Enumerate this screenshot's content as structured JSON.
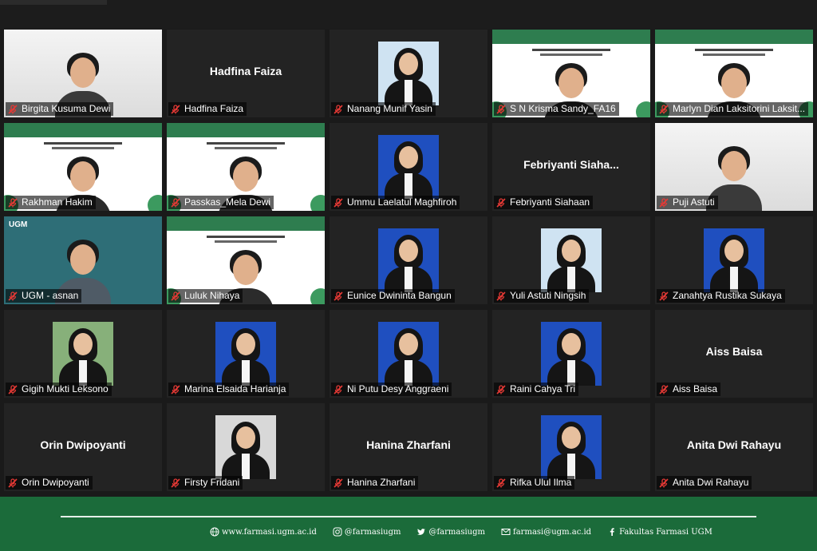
{
  "colors": {
    "background": "#1a1a1a",
    "tile": "#232323",
    "footer": "#1b6b3a",
    "active_border": "#d9e35a",
    "mic_off": "#e53935"
  },
  "participants": [
    {
      "name": "Birgita Kusuma Dewi",
      "video": "webcam"
    },
    {
      "name": "Hadfina Faiza",
      "video": "none"
    },
    {
      "name": "Nanang Munif Yasin",
      "video": "photo"
    },
    {
      "name": "S N Krisma Sandy_FA16",
      "video": "slide"
    },
    {
      "name": "Marlyn Dian Laksitorini Laksit...",
      "video": "slide"
    },
    {
      "name": "Rakhman Hakim",
      "video": "slide"
    },
    {
      "name": "Passkas_Mela Dewi",
      "video": "slide"
    },
    {
      "name": "Ummu Laelatul Maghfiroh",
      "video": "photo"
    },
    {
      "name": "Febriyanti Siahaan",
      "display_name": "Febriyanti  Siaha...",
      "video": "none"
    },
    {
      "name": "Puji Astuti",
      "video": "webcam",
      "active": true
    },
    {
      "name": "UGM - asnan",
      "video": "ugm",
      "logo": "UGM"
    },
    {
      "name": "Luluk Nihaya",
      "video": "slide"
    },
    {
      "name": "Eunice Dwininta Bangun",
      "video": "photo"
    },
    {
      "name": "Yuli Astuti Ningsih",
      "video": "photo"
    },
    {
      "name": "Zanahtya Rustika Sukaya",
      "video": "photo"
    },
    {
      "name": "Gigih Mukti Leksono",
      "video": "photo"
    },
    {
      "name": "Marina Elsaida Harianja",
      "video": "photo"
    },
    {
      "name": "Ni Putu Desy Anggraeni",
      "video": "photo"
    },
    {
      "name": "Raini Cahya Tri",
      "video": "photo"
    },
    {
      "name": "Aiss Baisa",
      "video": "none"
    },
    {
      "name": "Orin Dwipoyanti",
      "video": "none"
    },
    {
      "name": "Firsty Fridani",
      "video": "photo"
    },
    {
      "name": "Hanina Zharfani",
      "video": "none"
    },
    {
      "name": "Rifka Ulul Ilma",
      "video": "photo"
    },
    {
      "name": "Anita Dwi Rahayu",
      "video": "none"
    }
  ],
  "footer": {
    "website": "www.farmasi.ugm.ac.id",
    "instagram": "@farmasiugm",
    "twitter": "@farmasiugm",
    "email": "farmasi@ugm.ac.id",
    "facebook": "Fakultas Farmasi UGM"
  }
}
